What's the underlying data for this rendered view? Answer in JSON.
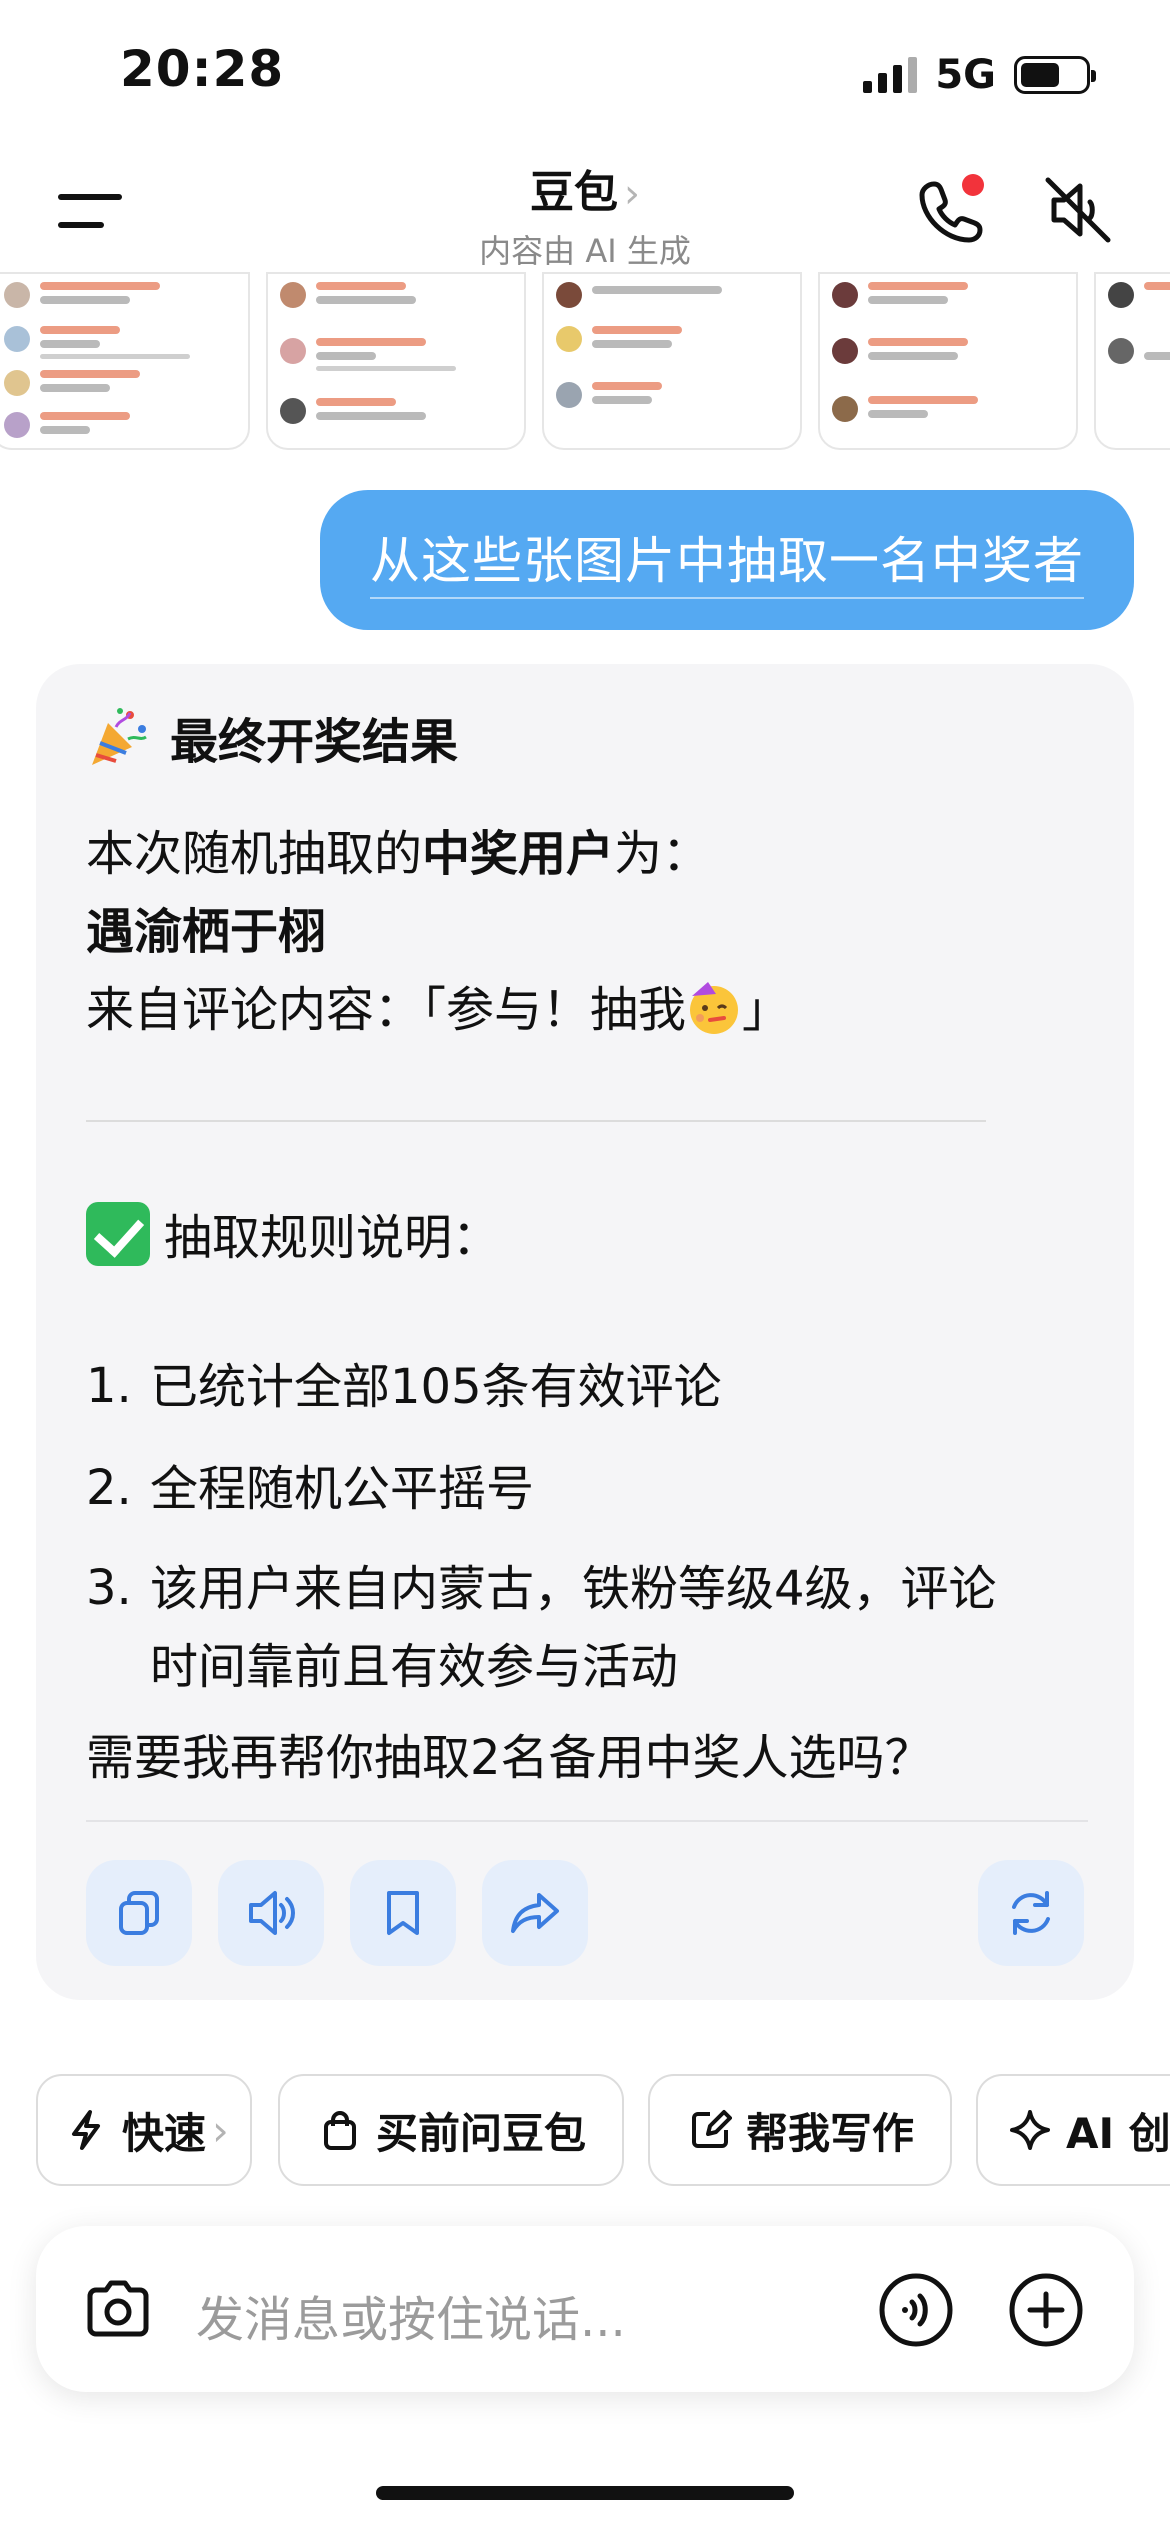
{
  "status_bar": {
    "time": "20:28",
    "network": "5G"
  },
  "header": {
    "title": "豆包",
    "title_chevron": "›",
    "subtitle": "内容由 AI 生成"
  },
  "user_message": {
    "text": "从这些张图片中抽取一名中奖者"
  },
  "ai_message": {
    "heading": "最终开奖结果",
    "intro_prefix": "本次随机抽取的",
    "intro_bold": "中奖用户",
    "intro_suffix": "为：",
    "winner_name": "遇渝栖于栩",
    "comment_text": "来自评论内容：「参与！抽我",
    "comment_close": "」",
    "rules_heading": "抽取规则说明：",
    "rules": [
      {
        "num": "1.",
        "lines": [
          "已统计全部105条有效评论"
        ]
      },
      {
        "num": "2.",
        "lines": [
          "全程随机公平摇号"
        ]
      },
      {
        "num": "3.",
        "lines": [
          "该用户来自内蒙古，铁粉等级4级，评论",
          "时间靠前且有效参与活动"
        ]
      }
    ],
    "followup": "需要我再帮你抽取2名备用中奖人选吗？",
    "actions": [
      "copy-icon",
      "speaker-icon",
      "bookmark-icon",
      "share-icon",
      "regenerate-icon"
    ]
  },
  "quick_chips": [
    {
      "label": "快速",
      "icon": "lightning-icon",
      "chevron": "›"
    },
    {
      "label": "买前问豆包",
      "icon": "shopping-bag-icon"
    },
    {
      "label": "帮我写作",
      "icon": "edit-icon"
    },
    {
      "label": "AI 创作",
      "icon": "sparkle-icon"
    }
  ],
  "input": {
    "placeholder": "发消息或按住说话..."
  },
  "colors": {
    "accent": "#55a9f2",
    "icon_blue": "#3b7de0",
    "notification": "#f2333b"
  }
}
